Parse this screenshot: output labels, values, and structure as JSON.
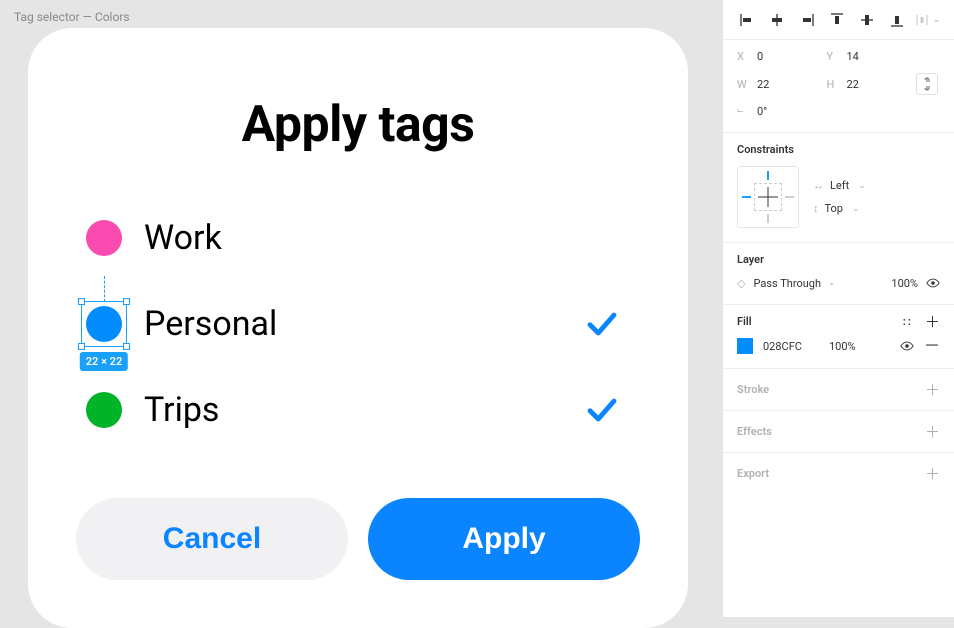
{
  "breadcrumb": "Tag selector — Colors",
  "modal": {
    "title": "Apply tags",
    "tags": [
      {
        "label": "Work",
        "color": "#f94bb0",
        "checked": false,
        "selected": false
      },
      {
        "label": "Personal",
        "color": "#028cfc",
        "checked": true,
        "selected": true
      },
      {
        "label": "Trips",
        "color": "#00b329",
        "checked": true,
        "selected": false
      }
    ],
    "selection_badge": "22 × 22",
    "cancel_label": "Cancel",
    "apply_label": "Apply"
  },
  "inspector": {
    "position": {
      "x_label": "X",
      "x": "0",
      "y_label": "Y",
      "y": "14",
      "w_label": "W",
      "w": "22",
      "h_label": "H",
      "h": "22",
      "rotation": "0°"
    },
    "constraints": {
      "title": "Constraints",
      "horizontal": "Left",
      "vertical": "Top"
    },
    "layer": {
      "title": "Layer",
      "blend_mode": "Pass Through",
      "opacity": "100%"
    },
    "fill": {
      "title": "Fill",
      "hex": "028CFC",
      "swatch": "#028cfc",
      "opacity": "100%"
    },
    "stroke_title": "Stroke",
    "effects_title": "Effects",
    "export_title": "Export"
  }
}
